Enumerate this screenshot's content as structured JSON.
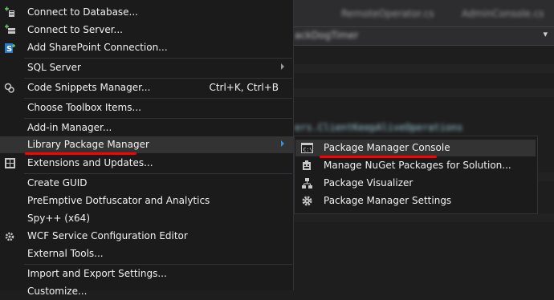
{
  "editor": {
    "tabs": [
      "RemoteOperator.cs",
      "AdminConsole.cs"
    ],
    "nav_text": "ackDogTimer",
    "code_line": "ers.ClientKeepAliveOperations"
  },
  "menu": {
    "items": [
      {
        "label": "Connect to Database...",
        "icon": "database-plus-icon"
      },
      {
        "label": "Connect to Server...",
        "icon": "server-plus-icon"
      },
      {
        "label": "Add SharePoint Connection...",
        "icon": "sharepoint-icon"
      },
      {
        "label": "SQL Server"
      },
      {
        "label": "Code Snippets Manager...",
        "shortcut": "Ctrl+K, Ctrl+B",
        "icon": "code-snippets-icon"
      },
      {
        "label": "Choose Toolbox Items..."
      },
      {
        "label": "Add-in Manager..."
      },
      {
        "label": "Library Package Manager"
      },
      {
        "label": "Extensions and Updates...",
        "icon": "extensions-icon"
      },
      {
        "label": "Create GUID"
      },
      {
        "label": "PreEmptive Dotfuscator and Analytics"
      },
      {
        "label": "Spy++ (x64)"
      },
      {
        "label": "WCF Service Configuration Editor",
        "icon": "wcf-gear-icon"
      },
      {
        "label": "External Tools..."
      },
      {
        "label": "Import and Export Settings..."
      },
      {
        "label": "Customize..."
      }
    ]
  },
  "submenu": {
    "items": [
      {
        "label": "Package Manager Console",
        "icon": "console-icon"
      },
      {
        "label": "Manage NuGet Packages for Solution...",
        "icon": "nuget-package-icon"
      },
      {
        "label": "Package Visualizer",
        "icon": "visualizer-icon"
      },
      {
        "label": "Package Manager Settings",
        "icon": "gear-icon"
      }
    ]
  },
  "colors": {
    "menu_bg": "#1b1b1c",
    "highlight": "#333334",
    "annotation": "#ff0000",
    "accent": "#3f8fd6"
  }
}
